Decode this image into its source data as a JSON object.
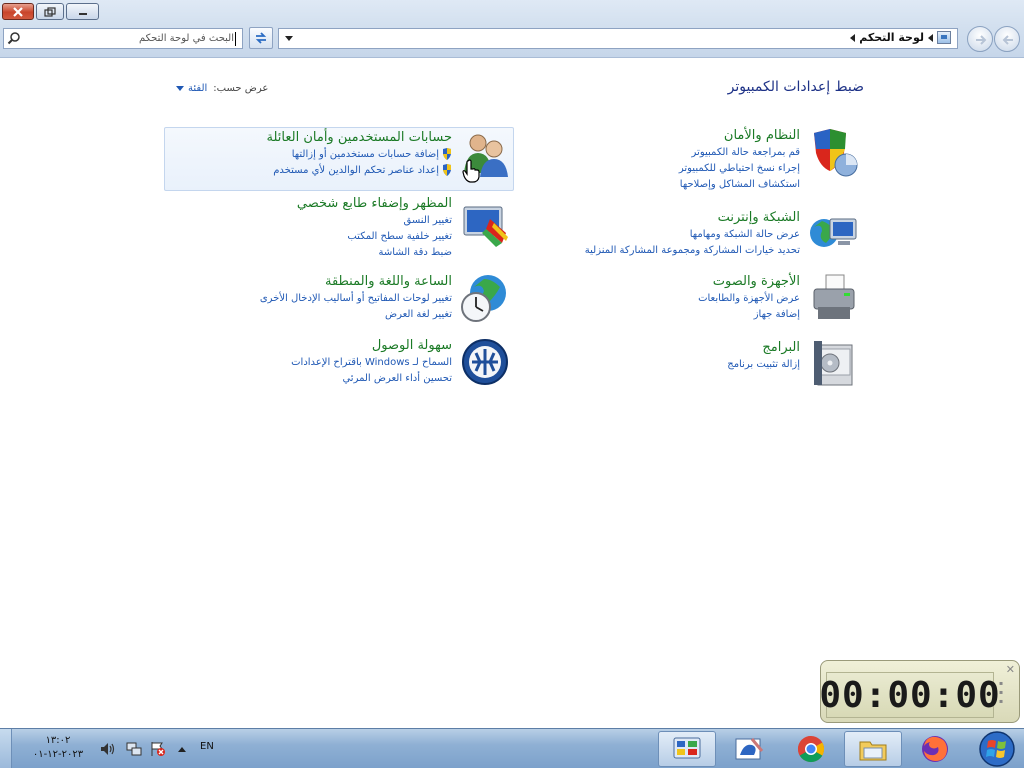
{
  "window": {
    "breadcrumb": "لوحة التحكم",
    "search_placeholder": "البحث في لوحة التحكم"
  },
  "content": {
    "heading": "ضبط إعدادات الكمبيوتر",
    "view_by_label": "عرض حسب:",
    "view_by_value": "الفئة"
  },
  "categories_right": [
    {
      "title": "النظام والأمان",
      "icon": "shield-pie-icon",
      "links": [
        "قم بمراجعة حالة الكمبيوتر",
        "إجراء نسخ احتياطي للكمبيوتر",
        "استكشاف المشاكل وإصلاحها"
      ]
    },
    {
      "title": "الشبكة وإنترنت",
      "icon": "network-globe-icon",
      "links": [
        "عرض حالة الشبكة ومهامها",
        "تحديد خيارات المشاركة ومجموعة المشاركة المنزلية"
      ]
    },
    {
      "title": "الأجهزة والصوت",
      "icon": "printer-icon",
      "links": [
        "عرض الأجهزة والطابعات",
        "إضافة جهاز"
      ]
    },
    {
      "title": "البرامج",
      "icon": "programs-icon",
      "links": [
        "إزالة تثبيت برنامج"
      ]
    }
  ],
  "categories_left": [
    {
      "title": "حسابات المستخدمين وأمان العائلة",
      "icon": "users-icon",
      "links": [
        "إضافة حسابات مستخدمين أو إزالتها",
        "إعداد عناصر تحكم الوالدين لأي مستخدم"
      ]
    },
    {
      "title": "المظهر وإضفاء طابع شخصي",
      "icon": "appearance-icon",
      "links": [
        "تغيير النسق",
        "تغيير خلفية سطح المكتب",
        "ضبط دقة الشاشة"
      ]
    },
    {
      "title": "الساعة واللغة والمنطقة",
      "icon": "clock-globe-icon",
      "links": [
        "تغيير لوحات المفاتيح أو أساليب الإدخال الأخرى",
        "تغيير لغة العرض"
      ]
    },
    {
      "title": "سهولة الوصول",
      "icon": "ease-of-access-icon",
      "links": [
        "السماح لـ Windows باقتراح الإعدادات",
        "تحسين أداء العرض المرئي"
      ]
    }
  ],
  "gadget": {
    "time": "00:00:00"
  },
  "taskbar": {
    "time": "١٣:٠٢",
    "date": "٢٠٢٣-١٢-٠١",
    "language": "EN"
  },
  "colors": {
    "category_title": "#1b7a26",
    "link": "#1f58b4",
    "heading": "#1e3287"
  }
}
